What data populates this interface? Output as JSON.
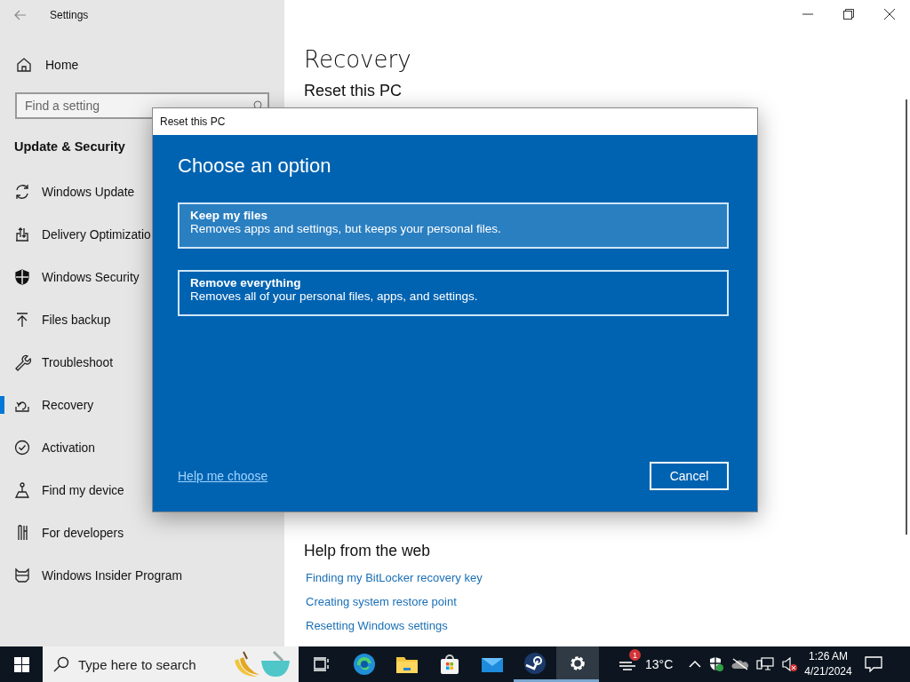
{
  "window": {
    "title": "Settings"
  },
  "sidebar": {
    "home": "Home",
    "search": {
      "placeholder": "Find a setting"
    },
    "section": "Update & Security",
    "items": [
      {
        "kind": "update",
        "label": "Windows Update",
        "selected": false
      },
      {
        "kind": "delivery",
        "label": "Delivery Optimizatio",
        "selected": false
      },
      {
        "kind": "shield",
        "label": "Windows Security",
        "selected": false
      },
      {
        "kind": "backup",
        "label": "Files backup",
        "selected": false
      },
      {
        "kind": "wrench",
        "label": "Troubleshoot",
        "selected": false
      },
      {
        "kind": "recovery",
        "label": "Recovery",
        "selected": true
      },
      {
        "kind": "activation",
        "label": "Activation",
        "selected": false
      },
      {
        "kind": "find",
        "label": "Find my device",
        "selected": false
      },
      {
        "kind": "developers",
        "label": "For developers",
        "selected": false
      },
      {
        "kind": "insider",
        "label": "Windows Insider Program",
        "selected": false
      }
    ]
  },
  "content": {
    "title": "Recovery",
    "section": "Reset this PC",
    "help_title": "Help from the web",
    "links": [
      "Finding my BitLocker recovery key",
      "Creating system restore point",
      "Resetting Windows settings"
    ]
  },
  "dialog": {
    "title": "Reset this PC",
    "heading": "Choose an option",
    "options": [
      {
        "title": "Keep my files",
        "description": "Removes apps and settings, but keeps your personal files.",
        "selected": true
      },
      {
        "title": "Remove everything",
        "description": "Removes all of your personal files, apps, and settings.",
        "selected": false
      }
    ],
    "help_link": "Help me choose",
    "cancel": "Cancel"
  },
  "taskbar": {
    "search": {
      "placeholder": "Type here to search"
    },
    "apps": [
      {
        "kind": "taskview",
        "selected": false,
        "running": false
      },
      {
        "kind": "edge",
        "selected": false,
        "running": false
      },
      {
        "kind": "explorer",
        "selected": false,
        "running": false
      },
      {
        "kind": "store",
        "selected": false,
        "running": false
      },
      {
        "kind": "mail",
        "selected": false,
        "running": false
      },
      {
        "kind": "steam",
        "selected": false,
        "running": true
      },
      {
        "kind": "settings",
        "selected": true,
        "running": true
      }
    ],
    "weather": {
      "badge": "1",
      "temperature": "13°C"
    },
    "time": "1:26 AM",
    "date": "4/21/2024"
  }
}
